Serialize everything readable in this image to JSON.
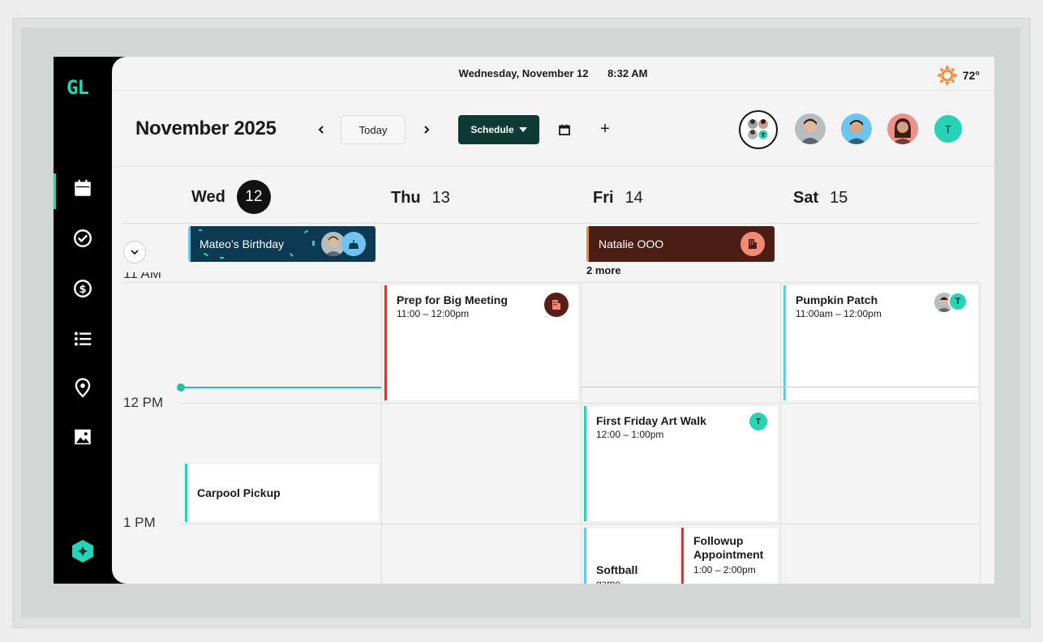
{
  "app": {
    "logo": "GL"
  },
  "status_bar": {
    "date": "Wednesday, November 12",
    "time": "8:32 AM",
    "temperature": "72°",
    "weather_icon": "sun-icon"
  },
  "toolbar": {
    "month_title": "November 2025",
    "prev_label": "‹",
    "today_label": "Today",
    "next_label": "›",
    "view_label": "Schedule",
    "add_label": "+"
  },
  "profiles": [
    {
      "name": "family-group",
      "initial": ""
    },
    {
      "name": "member-1",
      "initial": ""
    },
    {
      "name": "member-2",
      "initial": ""
    },
    {
      "name": "member-3",
      "initial": ""
    },
    {
      "name": "member-t",
      "initial": "T"
    }
  ],
  "days": [
    {
      "dow": "Wed",
      "num": "12",
      "today": true
    },
    {
      "dow": "Thu",
      "num": "13",
      "today": false
    },
    {
      "dow": "Fri",
      "num": "14",
      "today": false
    },
    {
      "dow": "Sat",
      "num": "15",
      "today": false
    }
  ],
  "all_day": [
    {
      "title": "Mateo’s Birthday",
      "color": "#0c3a52",
      "day": 0
    },
    {
      "title": "Natalie OOO",
      "color": "#4a1d15",
      "day": 2
    }
  ],
  "more_label": "2 more",
  "time_labels": [
    "11 AM",
    "12 PM",
    "1 PM"
  ],
  "events": [
    {
      "title": "Prep for Big Meeting",
      "time": "11:00 – 12:00pm",
      "color": "#c2413a",
      "badge": "building"
    },
    {
      "title": "Pumpkin Patch",
      "time": "11:00am – 12:00pm",
      "color": "#6ec4ef",
      "badge": "photo+T"
    },
    {
      "title": "First Friday Art Walk",
      "time": "12:00 – 1:00pm",
      "color": "#25d3b6",
      "badge": "T"
    },
    {
      "title": "Carpool Pickup",
      "time": "",
      "color": "#25d3b6",
      "badge": ""
    },
    {
      "title": "Softball",
      "time": "game",
      "color": "#6ec4ef",
      "badge": ""
    },
    {
      "title": "Followup Appointment",
      "time": "1:00 – 2:00pm",
      "color": "#c2413a",
      "badge": ""
    }
  ],
  "colors": {
    "accent": "#25d3b6",
    "schedule_button": "#0e3a34",
    "sun": "#f08a3c"
  }
}
